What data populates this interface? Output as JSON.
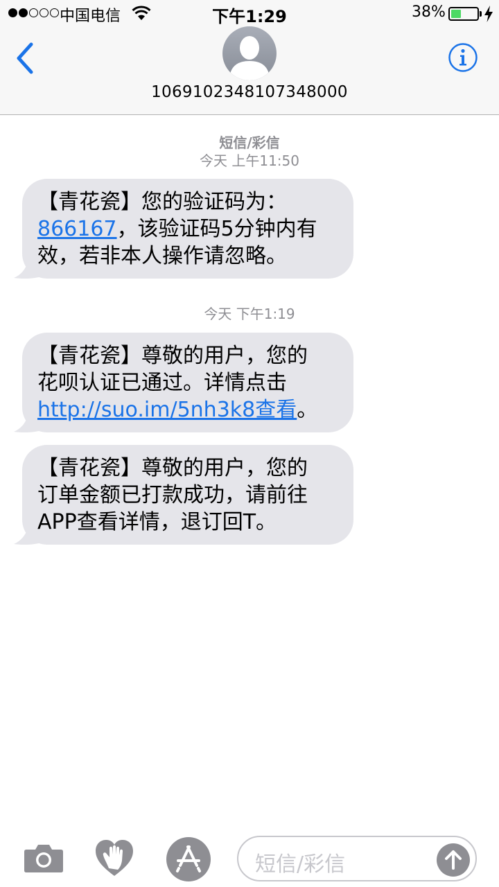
{
  "status_bar": {
    "carrier": "中国电信",
    "time": "下午1:29",
    "battery_percent_text": "38%",
    "battery_level": 0.38,
    "signal_bars_filled": 2,
    "signal_bars_total": 5
  },
  "nav": {
    "back_icon": "chevron-left-icon",
    "contact_number": "1069102348107348000",
    "info_icon": "info-icon"
  },
  "conversation": {
    "service_label": "短信/彩信",
    "messages": [
      {
        "timestamp": "今天 上午11:50",
        "lines": [
          "【青花瓷】您的验证码为：",
          "866167，该验证码5分钟内有",
          "效，若非本人操作请忽略。"
        ],
        "link": "866167",
        "rest_line2": "，该验证码5分钟内有"
      },
      {
        "timestamp": "今天 下午1:19",
        "line1": "【青花瓷】尊敬的用户，您的",
        "line2": "花呗认证已通过。详情点击",
        "link": "http://suo.im/5nh3k8查看",
        "tail": "。"
      },
      {
        "line1": "【青花瓷】尊敬的用户，您的",
        "line2": "订单金额已打款成功，请前往",
        "line3": "APP查看详情，退订回T。"
      }
    ]
  },
  "input_bar": {
    "camera_icon": "camera-icon",
    "digital_touch_icon": "digital-touch-icon",
    "appstore_icon": "appstore-icon",
    "placeholder": "短信/彩信",
    "send_icon": "arrow-up-icon"
  },
  "colors": {
    "accent": "#1a73e8",
    "bubble": "#e5e5ea",
    "battery": "#4cd964",
    "secondary_text": "#8e8e93"
  }
}
